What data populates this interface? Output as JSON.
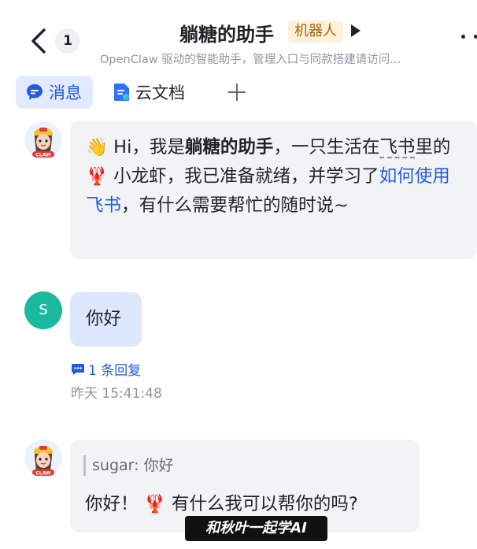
{
  "header": {
    "unread_count": "1",
    "title": "躺糖的助手",
    "badge": "机器人",
    "subtitle": "OpenClaw 驱动的智能助手，管理入口与同款搭建请访问..."
  },
  "tabs": [
    {
      "label": "消息",
      "icon": "message-icon",
      "active": true
    },
    {
      "label": "云文档",
      "icon": "doc-icon",
      "active": false
    }
  ],
  "messages": {
    "bot_intro": {
      "part1": "Hi，我是",
      "bold_name": "躺糖的助手",
      "part2": "，一只生活在",
      "dashed": "飞书",
      "part3": "里的",
      "part4": "小龙虾，我已准备就绪，并学习了",
      "link": "如何使用飞书",
      "part5": "，有什么需要帮忙的随时说~"
    },
    "user_avatar_letter": "S",
    "user_message": "你好",
    "reply_count": "1 条回复",
    "timestamp": "昨天 15:41:48",
    "quote": "sugar: 你好",
    "bot_reply_part1": "你好！",
    "bot_reply_part2": "有什么我可以帮你的吗?"
  },
  "watermark": "和秋叶一起学AI"
}
